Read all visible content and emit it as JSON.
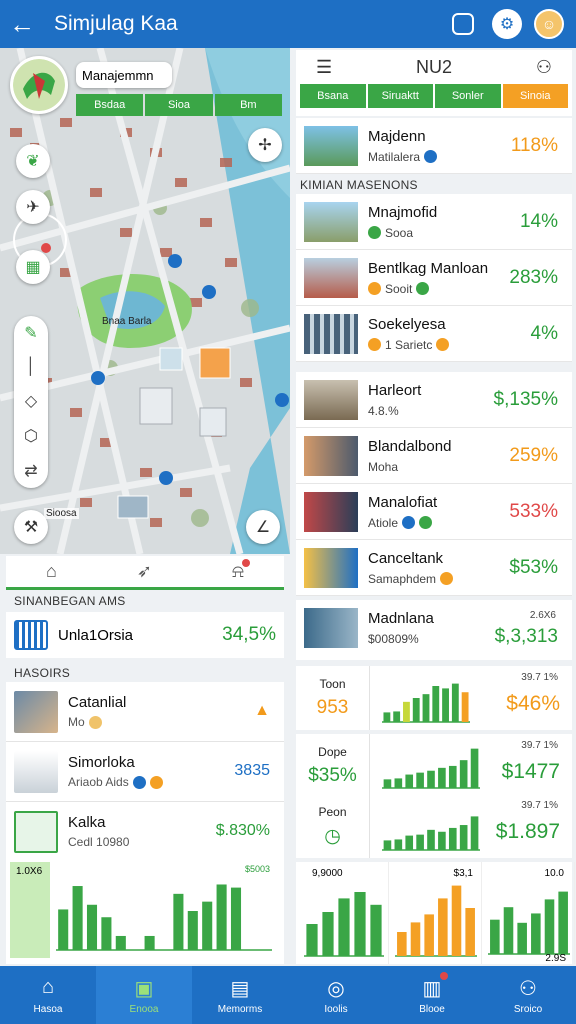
{
  "header": {
    "title": "Simjulag Kaa",
    "back_icon": "arrow-left-icon"
  },
  "map": {
    "card_label": "Manajemmn",
    "tabs": [
      "Bsdaa",
      "Sioa",
      "Bm"
    ],
    "park_label": "Bnaa Barla",
    "street_label": "Sioosa"
  },
  "left": {
    "section1": "SINANBEGAN AMS",
    "stat": {
      "label": "Unla1Orsia",
      "value": "34,5%"
    },
    "section2": "HASOIRS",
    "items": [
      {
        "title": "Catanlial",
        "sub": "Mo",
        "right": ""
      },
      {
        "title": "Simorloka",
        "sub": "Ariaob Aids",
        "right": "3835"
      },
      {
        "title": "Kalka",
        "sub": "Cedl 10980",
        "right": "$.830%"
      }
    ],
    "chart_left_label": "1.0X6",
    "chart_right_label": "$5003"
  },
  "right": {
    "head_label": "NU2",
    "tabs": [
      "Bsana",
      "Siruaktt",
      "Sonler",
      "Sinoia"
    ],
    "top_item": {
      "title": "Majdenn",
      "sub": "Matilalera",
      "value": "118%"
    },
    "section": "KIMIAN MASENONS",
    "group1": [
      {
        "title": "Mnajmofid",
        "sub": "Sooa",
        "value": "14%"
      },
      {
        "title": "Bentlkag Manloan",
        "sub": "Sooit",
        "value": "283%"
      },
      {
        "title": "Soekelyesa",
        "sub": "1 Sarietc",
        "value": "4%"
      }
    ],
    "group2": [
      {
        "title": "Harleort",
        "sub": "4.8.%",
        "value": "$,135%"
      },
      {
        "title": "Blandalbond",
        "sub": "Moha",
        "value": "259%"
      },
      {
        "title": "Manalofiat",
        "sub": "Atiole",
        "value": "533%"
      },
      {
        "title": "Canceltank",
        "sub": "Samaphdem",
        "value": "$53%"
      }
    ],
    "feature": {
      "title": "Madnlana",
      "sub": "$00809%",
      "small": "2.6X6",
      "value": "$,3,313"
    },
    "mini": [
      {
        "label": "Toon",
        "big": "953",
        "small": "39.7 1%",
        "value": "$46%"
      },
      {
        "label": "Dope",
        "big": "$35%",
        "small": "39.7 1%",
        "value": "$1477"
      },
      {
        "label": "Peon",
        "big": "",
        "small": "39.7 1%",
        "value": "$1.897"
      }
    ],
    "bottom_label_left": "9,9000",
    "bottom_label_mid": "$3,1",
    "bottom_label_right": "10.0",
    "bottom_foot": "2.9S"
  },
  "chart_data": [
    {
      "type": "bar",
      "categories": [
        "a",
        "b",
        "c",
        "d",
        "e",
        "f",
        "g",
        "h",
        "i",
        "j",
        "k",
        "l",
        "m",
        "n",
        "o"
      ],
      "values": [
        52,
        82,
        58,
        42,
        18,
        0,
        18,
        0,
        72,
        50,
        62,
        84,
        80,
        0,
        0
      ]
    },
    {
      "type": "bar",
      "categories": [
        "1",
        "2",
        "3",
        "4",
        "5",
        "6",
        "7",
        "8",
        "9"
      ],
      "values": [
        20,
        22,
        42,
        50,
        58,
        75,
        70,
        80,
        62
      ]
    },
    {
      "type": "bar",
      "categories": [
        "1",
        "2",
        "3",
        "4",
        "5",
        "6",
        "7",
        "8",
        "9"
      ],
      "values": [
        18,
        20,
        28,
        32,
        36,
        42,
        46,
        58,
        82
      ]
    },
    {
      "type": "bar",
      "categories": [
        "1",
        "2",
        "3",
        "4",
        "5",
        "6",
        "7",
        "8",
        "9"
      ],
      "values": [
        20,
        22,
        30,
        32,
        42,
        38,
        46,
        52,
        70
      ]
    }
  ],
  "nav": [
    "Hasoa",
    "Enooa",
    "Memorms",
    "Ioolis",
    "Blooe",
    "Sroico"
  ],
  "colors": {
    "primary": "#1e6fc4",
    "green": "#3aa646",
    "orange": "#f4a024"
  }
}
